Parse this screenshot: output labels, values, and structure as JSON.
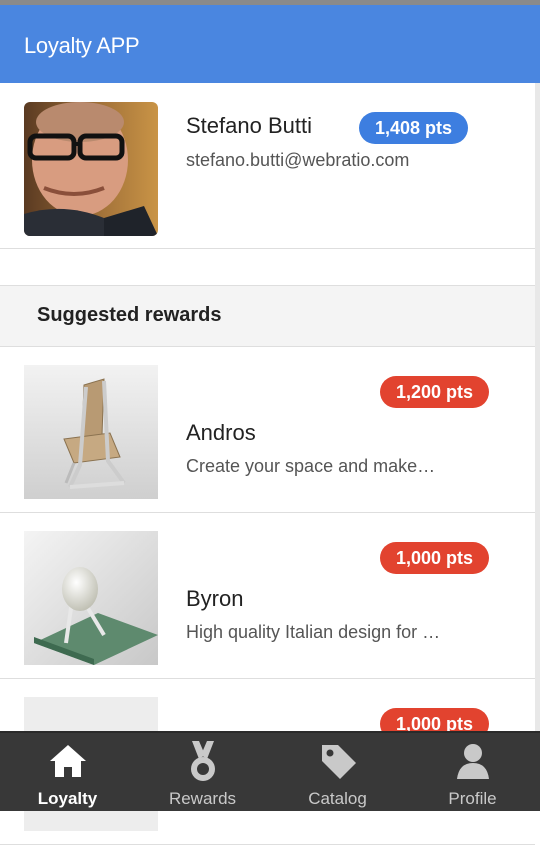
{
  "app": {
    "title": "Loyalty APP"
  },
  "user": {
    "name": "Stefano Butti",
    "email": "stefano.butti@webratio.com",
    "points": "1,408 pts"
  },
  "section": {
    "title": "Suggested rewards"
  },
  "rewards": [
    {
      "name": "Andros",
      "description": "Create your space and make…",
      "points": "1,200 pts",
      "image": "chair-image"
    },
    {
      "name": "Byron",
      "description": "High quality Italian design for …",
      "points": "1,000 pts",
      "image": "lamp-image"
    },
    {
      "name": "",
      "description": "",
      "points": "1,000 pts",
      "image": "product-image"
    }
  ],
  "tabs": [
    {
      "label": "Loyalty",
      "icon": "home-icon",
      "active": true
    },
    {
      "label": "Rewards",
      "icon": "medal-icon",
      "active": false
    },
    {
      "label": "Catalog",
      "icon": "tag-icon",
      "active": false
    },
    {
      "label": "Profile",
      "icon": "person-icon",
      "active": false
    }
  ],
  "colors": {
    "header": "#4a86e0",
    "user_badge": "#3d7ee0",
    "reward_badge": "#e2432f",
    "tabbar": "#383838"
  }
}
